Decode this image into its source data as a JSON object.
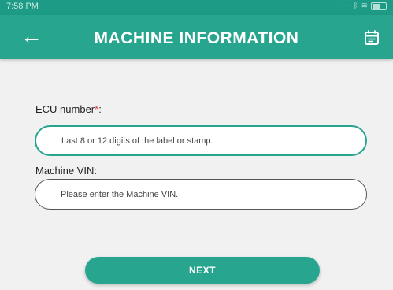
{
  "status_bar": {
    "time": "7:58 PM",
    "icons": [
      "signal-icon",
      "bluetooth-icon",
      "wifi-icon",
      "battery-icon"
    ]
  },
  "app_bar": {
    "title": "MACHINE INFORMATION",
    "back_icon": "arrow-left-icon",
    "action_icon": "calendar-icon"
  },
  "form": {
    "ecu": {
      "label": "ECU number",
      "required_mark": "*",
      "colon": ":",
      "placeholder": "Last 8 or 12 digits of the label or stamp.",
      "value": ""
    },
    "vin": {
      "label": "Machine VIN:",
      "placeholder": "Please enter the Machine VIN.",
      "value": ""
    }
  },
  "actions": {
    "next_label": "NEXT"
  },
  "colors": {
    "primary": "#27a58f",
    "status_bar": "#1e9b86",
    "background": "#f1f1f1",
    "required": "#e53935"
  }
}
